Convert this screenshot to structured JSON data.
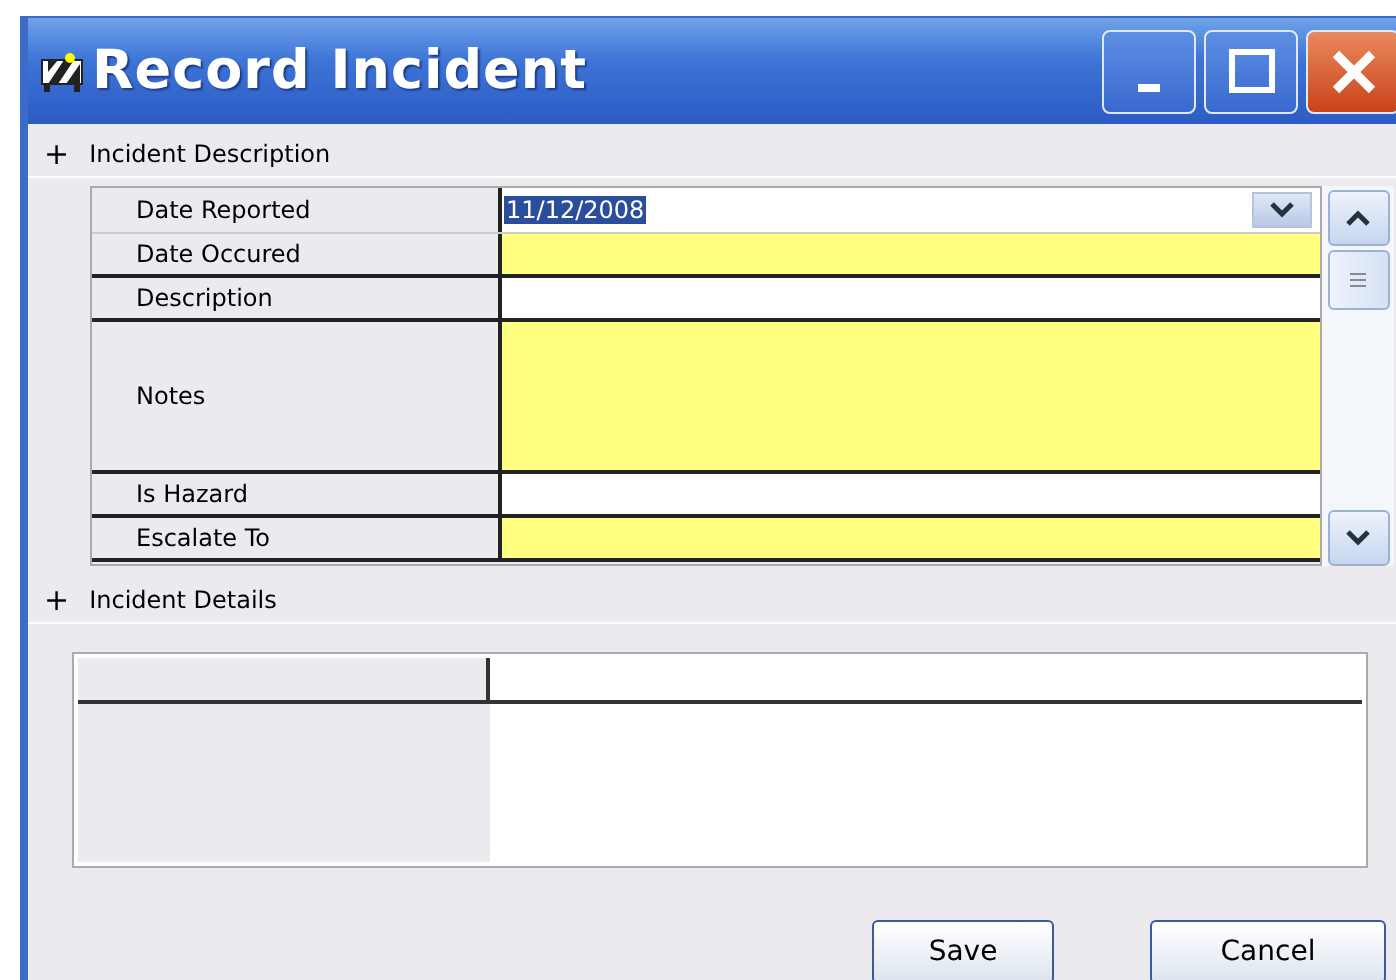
{
  "window": {
    "title": "Record Incident"
  },
  "sections": [
    {
      "label": "Incident Description",
      "expander": "+"
    },
    {
      "label": "Incident Details",
      "expander": "+"
    }
  ],
  "fields": [
    {
      "label": "Date Reported",
      "kind": "date",
      "value": "11/12/2008",
      "highlighted": true,
      "required": false
    },
    {
      "label": "Date Occured",
      "kind": "text",
      "required": true
    },
    {
      "label": "Description",
      "kind": "text",
      "required": false
    },
    {
      "label": "Notes",
      "kind": "memo",
      "required": true
    },
    {
      "label": "Is Hazard",
      "kind": "text",
      "required": false
    },
    {
      "label": "Escalate To",
      "kind": "text",
      "required": true
    }
  ],
  "buttons": [
    "Save",
    "Cancel"
  ]
}
